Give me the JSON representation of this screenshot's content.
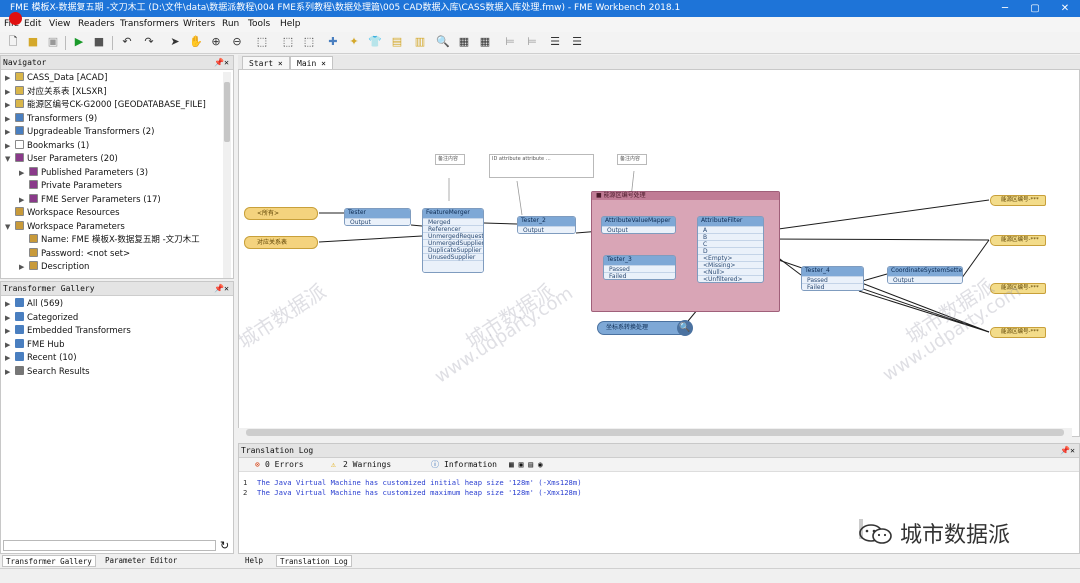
{
  "window": {
    "title": "FME 模板X-数据复五期 -文刀木工 (D:\\文件\\data\\数据派教程\\004 FME系列教程\\数据处理篇\\005 CAD数据入库\\CASS数据入库处理.fmw) - FME Workbench 2018.1"
  },
  "menu": [
    "File",
    "Edit",
    "View",
    "Readers",
    "Transformers",
    "Writers",
    "Run",
    "Tools",
    "Help"
  ],
  "navigator": {
    "title": "Navigator",
    "items": [
      {
        "label": "CASS_Data [ACAD]",
        "level": 0,
        "arrow": "▶",
        "icon": "#d9b64a"
      },
      {
        "label": "对应关系表 [XLSXR]",
        "level": 0,
        "arrow": "▶",
        "icon": "#d9b64a"
      },
      {
        "label": "能源区编号CK-G2000 [GEODATABASE_FILE]",
        "level": 0,
        "arrow": "▶",
        "icon": "#d9b64a"
      },
      {
        "label": "Transformers (9)",
        "level": 0,
        "arrow": "▶",
        "icon": "#4a7fc0"
      },
      {
        "label": "Upgradeable Transformers (2)",
        "level": 0,
        "arrow": "▶",
        "icon": "#4a7fc0"
      },
      {
        "label": "Bookmarks (1)",
        "level": 0,
        "arrow": "▶",
        "icon": "#ffffff"
      },
      {
        "label": "User Parameters (20)",
        "level": 0,
        "arrow": "▼",
        "icon": "#8a3a8a"
      },
      {
        "label": "Published Parameters (3)",
        "level": 1,
        "arrow": "▶",
        "icon": "#8a3a8a"
      },
      {
        "label": "Private Parameters",
        "level": 1,
        "arrow": "",
        "icon": "#8a3a8a"
      },
      {
        "label": "FME Server Parameters (17)",
        "level": 1,
        "arrow": "▶",
        "icon": "#8a3a8a"
      },
      {
        "label": "Workspace Resources",
        "level": 0,
        "arrow": "",
        "icon": "#c89a3a"
      },
      {
        "label": "Workspace Parameters",
        "level": 0,
        "arrow": "▼",
        "icon": "#c89a3a"
      },
      {
        "label": "Name: FME 模板X-数据复五期 -文刀木工",
        "level": 1,
        "arrow": "",
        "icon": "#c89a3a"
      },
      {
        "label": "Password: <not set>",
        "level": 1,
        "arrow": "",
        "icon": "#c89a3a"
      },
      {
        "label": "Description",
        "level": 1,
        "arrow": "▶",
        "icon": "#c89a3a"
      }
    ]
  },
  "gallery": {
    "title": "Transformer Gallery",
    "items": [
      {
        "label": "All (569)",
        "icon": "#4a7fc0"
      },
      {
        "label": "Categorized",
        "icon": "#4a7fc0"
      },
      {
        "label": "Embedded Transformers",
        "icon": "#4a7fc0"
      },
      {
        "label": "FME Hub",
        "icon": "#4a7fc0"
      },
      {
        "label": "Recent (10)",
        "icon": "#4a7fc0"
      },
      {
        "label": "Search Results",
        "icon": "#777777"
      }
    ]
  },
  "left_tabs": [
    "Transformer Gallery",
    "Parameter Editor"
  ],
  "doc_tabs": [
    "Start",
    "Main"
  ],
  "canvas": {
    "readers": [
      "<所有>",
      "对应关系表"
    ],
    "annotations": [
      "备注内容",
      "备注内容",
      "ID   attribute   attribute  …"
    ],
    "bookmark": "能源区编号处理",
    "nodes": [
      {
        "title": "Tester",
        "ports": [
          "Output"
        ]
      },
      {
        "title": "FeatureMerger",
        "ports": [
          "Merged",
          "Referencer",
          "UnmergedRequestor",
          "UnmergedSupplier",
          "DuplicateSupplier",
          "UnusedSupplier"
        ]
      },
      {
        "title": "Tester_2",
        "ports": [
          "Output"
        ]
      },
      {
        "title": "AttributeValueMapper",
        "ports": [
          "Output"
        ]
      },
      {
        "title": "Tester_3",
        "ports": [
          "Passed",
          "Failed"
        ]
      },
      {
        "title": "AttributeFilter",
        "ports": [
          "A",
          "B",
          "C",
          "D",
          "<Empty>",
          "<Missing>",
          "<Null>",
          "<Unfiltered>"
        ]
      },
      {
        "title": "Tester_4",
        "ports": [
          "Passed",
          "Failed"
        ]
      },
      {
        "title": "CoordinateSystemSetter",
        "ports": [
          "Output"
        ]
      }
    ],
    "sink": "坐标系转换处理",
    "writers": [
      "能源区编号-***",
      "能源区编号-***",
      "能源区编号-***",
      "能源区编号-***"
    ]
  },
  "log": {
    "title": "Translation Log",
    "errors": "0 Errors",
    "warnings": "2 Warnings",
    "information": "Information",
    "lines": [
      {
        "n": "1",
        "text": "The Java Virtual Machine has customized initial heap size '128m' (-Xms128m)"
      },
      {
        "n": "2",
        "text": "The Java Virtual Machine has customized maximum heap size '128m' (-Xmx128m)"
      }
    ]
  },
  "bottom_tabs": [
    "Help",
    "Translation Log"
  ],
  "watermark": {
    "cn": "城市数据派",
    "en": "www.udparty.com"
  },
  "brand": "城市数据派"
}
